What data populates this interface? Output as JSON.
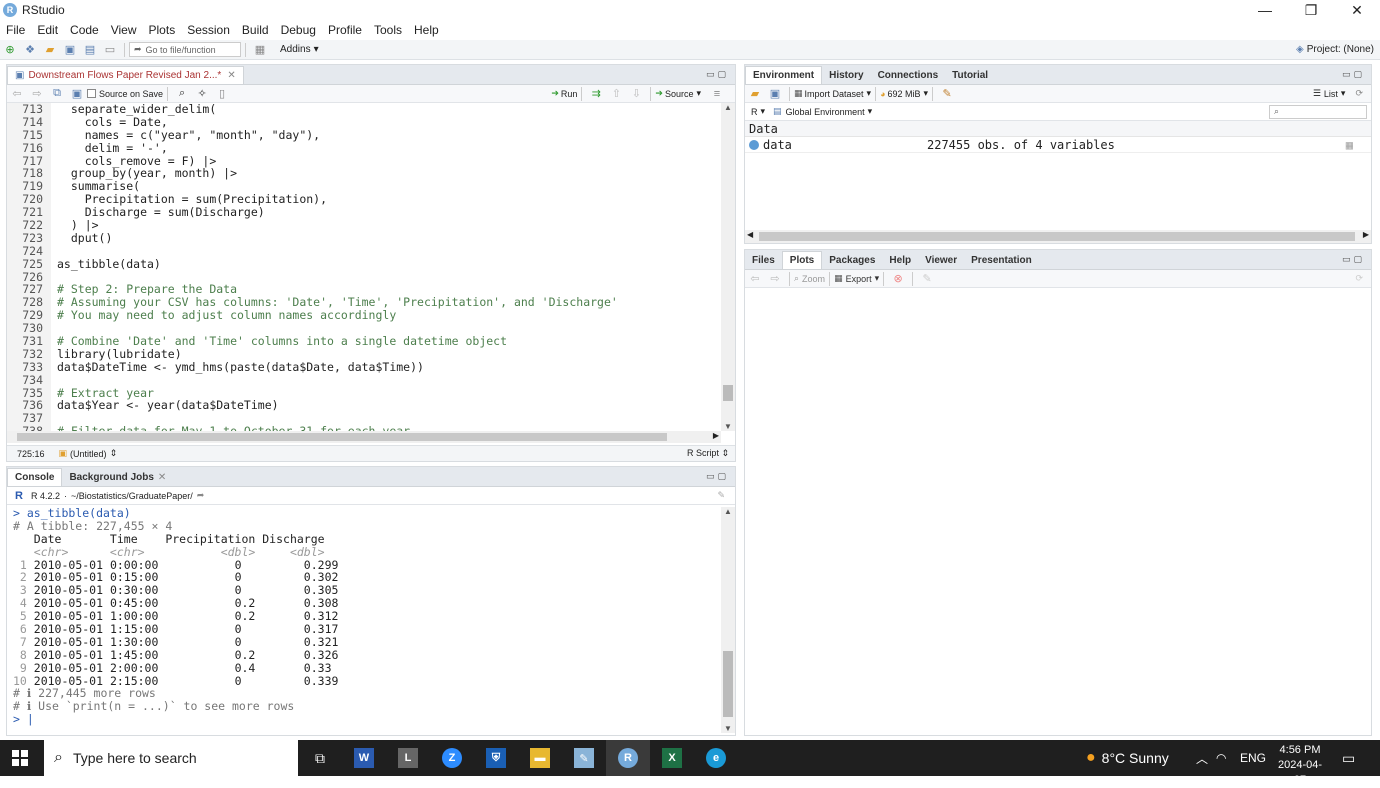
{
  "window": {
    "title": "RStudio",
    "min": "—",
    "max": "❐",
    "close": "✕"
  },
  "menu": [
    "File",
    "Edit",
    "Code",
    "View",
    "Plots",
    "Session",
    "Build",
    "Debug",
    "Profile",
    "Tools",
    "Help"
  ],
  "toolbar": {
    "goto_placeholder": "Go to file/function",
    "addins": "Addins",
    "project": "Project: (None)"
  },
  "editor": {
    "tab_label": "Downstream Flows Paper Revised Jan 2...*",
    "source_on_save": "Source on Save",
    "run": "Run",
    "source": "Source",
    "lines": [
      {
        "n": "713",
        "t": "  separate_wider_delim("
      },
      {
        "n": "714",
        "t": "    cols = Date,"
      },
      {
        "n": "715",
        "t": "    names = c(\"year\", \"month\", \"day\"),"
      },
      {
        "n": "716",
        "t": "    delim = '-',"
      },
      {
        "n": "717",
        "t": "    cols_remove = F) |>"
      },
      {
        "n": "718",
        "t": "  group_by(year, month) |>"
      },
      {
        "n": "719",
        "t": "  summarise("
      },
      {
        "n": "720",
        "t": "    Precipitation = sum(Precipitation),"
      },
      {
        "n": "721",
        "t": "    Discharge = sum(Discharge)"
      },
      {
        "n": "722",
        "t": "  ) |>"
      },
      {
        "n": "723",
        "t": "  dput()"
      },
      {
        "n": "724",
        "t": ""
      },
      {
        "n": "725",
        "t": "as_tibble(data)"
      },
      {
        "n": "726",
        "t": ""
      },
      {
        "n": "727",
        "t": "# Step 2: Prepare the Data"
      },
      {
        "n": "728",
        "t": "# Assuming your CSV has columns: 'Date', 'Time', 'Precipitation', and 'Discharge'"
      },
      {
        "n": "729",
        "t": "# You may need to adjust column names accordingly"
      },
      {
        "n": "730",
        "t": ""
      },
      {
        "n": "731",
        "t": "# Combine 'Date' and 'Time' columns into a single datetime object"
      },
      {
        "n": "732",
        "t": "library(lubridate)"
      },
      {
        "n": "733",
        "t": "data$DateTime <- ymd_hms(paste(data$Date, data$Time))"
      },
      {
        "n": "734",
        "t": ""
      },
      {
        "n": "735",
        "t": "# Extract year"
      },
      {
        "n": "736",
        "t": "data$Year <- year(data$DateTime)"
      },
      {
        "n": "737",
        "t": ""
      },
      {
        "n": "738",
        "t": "# Filter data for May 1 to October 31 for each year"
      }
    ],
    "status_pos": "725:16",
    "status_scope": "(Untitled)",
    "status_type": "R Script"
  },
  "console": {
    "tab_console": "Console",
    "tab_jobs": "Background Jobs",
    "rversion": "R 4.2.2",
    "path": "~/Biostatistics/GraduatePaper/",
    "lines": [
      {
        "k": "cmd",
        "t": "> as_tibble(data)"
      },
      {
        "k": "meta",
        "t": "# A tibble: 227,455 × 4"
      },
      {
        "k": "hdr",
        "t": "   Date       Time    Precipitation Discharge"
      },
      {
        "k": "typ",
        "t": "   <chr>      <chr>           <dbl>     <dbl>"
      },
      {
        "k": "row",
        "i": " 1",
        "t": " 2010-05-01 0:00:00           0         0.299"
      },
      {
        "k": "row",
        "i": " 2",
        "t": " 2010-05-01 0:15:00           0         0.302"
      },
      {
        "k": "row",
        "i": " 3",
        "t": " 2010-05-01 0:30:00           0         0.305"
      },
      {
        "k": "row",
        "i": " 4",
        "t": " 2010-05-01 0:45:00           0.2       0.308"
      },
      {
        "k": "row",
        "i": " 5",
        "t": " 2010-05-01 1:00:00           0.2       0.312"
      },
      {
        "k": "row",
        "i": " 6",
        "t": " 2010-05-01 1:15:00           0         0.317"
      },
      {
        "k": "row",
        "i": " 7",
        "t": " 2010-05-01 1:30:00           0         0.321"
      },
      {
        "k": "row",
        "i": " 8",
        "t": " 2010-05-01 1:45:00           0.2       0.326"
      },
      {
        "k": "row",
        "i": " 9",
        "t": " 2010-05-01 2:00:00           0.4       0.33"
      },
      {
        "k": "row",
        "i": "10",
        "t": " 2010-05-01 2:15:00           0         0.339"
      },
      {
        "k": "meta",
        "t": "# ℹ 227,445 more rows"
      },
      {
        "k": "meta",
        "t": "# ℹ Use `print(n = ...)` to see more rows"
      },
      {
        "k": "cmd",
        "t": "> |"
      }
    ]
  },
  "env": {
    "tabs": [
      "Environment",
      "History",
      "Connections",
      "Tutorial"
    ],
    "import": "Import Dataset",
    "memory": "692 MiB",
    "list": "List",
    "lang": "R",
    "scope": "Global Environment",
    "section": "Data",
    "var_name": "data",
    "var_desc": "227455 obs. of 4 variables"
  },
  "plots": {
    "tabs": [
      "Files",
      "Plots",
      "Packages",
      "Help",
      "Viewer",
      "Presentation"
    ],
    "zoom": "Zoom",
    "export": "Export"
  },
  "taskbar": {
    "search": "Type here to search",
    "weather": "8°C  Sunny",
    "lang": "ENG",
    "time": "4:56 PM",
    "date": "2024-04-07"
  }
}
